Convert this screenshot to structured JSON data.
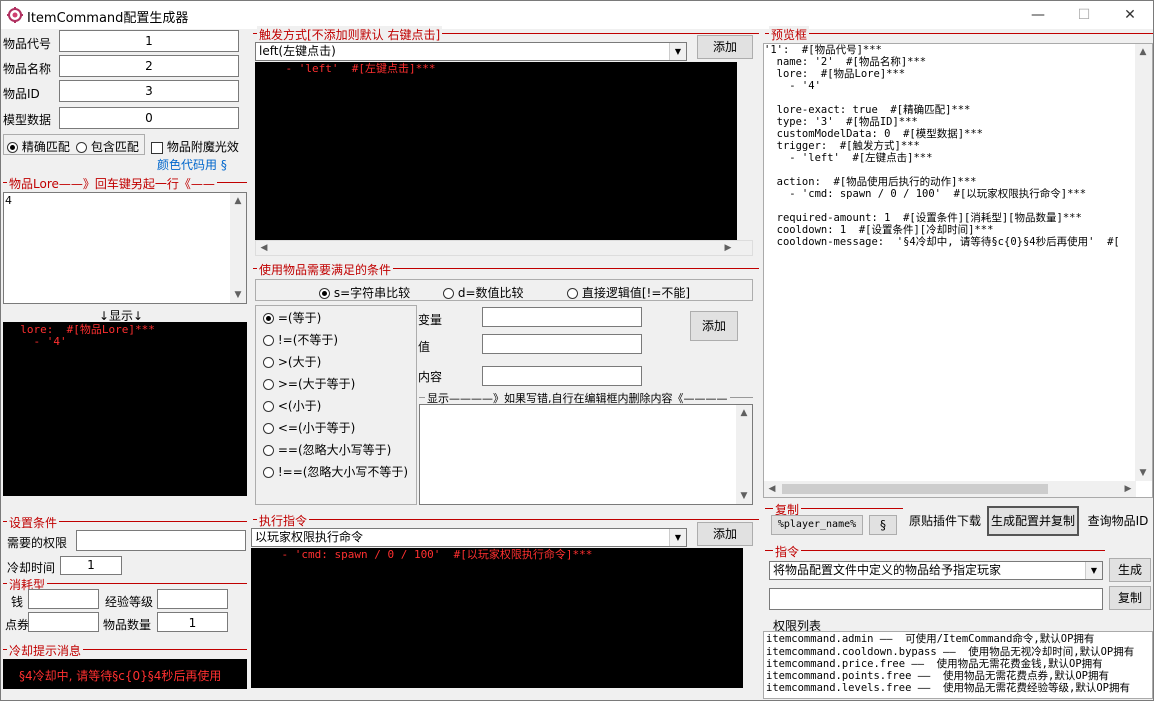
{
  "window": {
    "title": "ItemCommand配置生成器",
    "minimize": "—",
    "maximize": "☐",
    "close": "✕"
  },
  "item": {
    "code_label": "物品代号",
    "code_value": "1",
    "name_label": "物品名称",
    "name_value": "2",
    "id_label": "物品ID",
    "id_value": "3",
    "model_label": "模型数据",
    "model_value": "0",
    "exact_label": "精确匹配",
    "contain_label": "包含匹配",
    "enchant_label": "物品附魔光效",
    "color_code_link": "颜色代码用 §"
  },
  "lore": {
    "title": "物品Lore——》回车键另起一行《——",
    "input_value": "4",
    "display_label": "↓显示↓",
    "display_code": "  lore:  #[物品Lore]***\n    - '4'"
  },
  "trigger": {
    "title": "触发方式[不添加则默认 右键点击]",
    "selected": "left(左键点击)",
    "add_button": "添加",
    "code": "    - 'left'  #[左键点击]***"
  },
  "condition": {
    "title": "使用物品需要满足的条件",
    "type_options": [
      "s=字符串比较",
      "d=数值比较",
      "直接逻辑值[!=不能]"
    ],
    "operators": [
      "=(等于)",
      "!=(不等于)",
      ">(大于)",
      ">=(大于等于)",
      "<(小于)",
      "<=(小于等于)",
      "==(忽略大小写等于)",
      "!==(忽略大小写不等于)"
    ],
    "var_label": "变量",
    "value_label": "值",
    "content_label": "内容",
    "add_button": "添加",
    "display_title": "显示————》如果写错,自行在编辑框内删除内容《————"
  },
  "settings": {
    "title": "设置条件",
    "permission_label": "需要的权限",
    "permission_value": "",
    "cooldown_label": "冷却时间",
    "cooldown_value": "1",
    "consume_title": "消耗型",
    "money_label": "钱",
    "exp_label": "经验等级",
    "points_label": "点券",
    "amount_label": "物品数量",
    "amount_value": "1"
  },
  "cooldown_msg": {
    "title": "冷却提示消息",
    "text": "§4冷却中, 请等待§c{0}§4秒后再使用"
  },
  "exec": {
    "title": "执行指令",
    "selected": "以玩家权限执行命令",
    "add_button": "添加",
    "code": "    - 'cmd: spawn / 0 / 100'  #[以玩家权限执行命令]***"
  },
  "preview": {
    "title": "预览框",
    "text": "'1':  #[物品代号]***\n  name: '2'  #[物品名称]***\n  lore:  #[物品Lore]***\n    - '4'\n\n  lore-exact: true  #[精确匹配]***\n  type: '3'  #[物品ID]***\n  customModelData: 0  #[模型数据]***\n  trigger:  #[触发方式]***\n    - 'left'  #[左键点击]***\n\n  action:  #[物品使用后执行的动作]***\n    - 'cmd: spawn / 0 / 100'  #[以玩家权限执行命令]***\n\n  required-amount: 1  #[设置条件][消耗型][物品数量]***\n  cooldown: 1  #[设置条件][冷却时间]***\n  cooldown-message:  '§4冷却中, 请等待§c{0}§4秒后再使用'  #["
  },
  "copy": {
    "title": "复制",
    "player_name_button": "%player_name%",
    "section_button": "§",
    "download_button": "原贴插件下载",
    "generate_copy_button": "生成配置并复制",
    "query_button": "查询物品ID"
  },
  "command": {
    "title": "指令",
    "selected": "将物品配置文件中定义的物品给予指定玩家",
    "generate_button": "生成",
    "copy_button": "复制",
    "output_value": ""
  },
  "permissions": {
    "title": "权限列表",
    "lines": [
      "itemcommand.admin ——  可使用/ItemCommand命令,默认OP拥有",
      "itemcommand.cooldown.bypass ——  使用物品无视冷却时间,默认OP拥有",
      "itemcommand.price.free ——  使用物品无需花费金钱,默认OP拥有",
      "itemcommand.points.free ——  使用物品无需花费点券,默认OP拥有",
      "itemcommand.levels.free ——  使用物品无需花费经验等级,默认OP拥有"
    ]
  }
}
